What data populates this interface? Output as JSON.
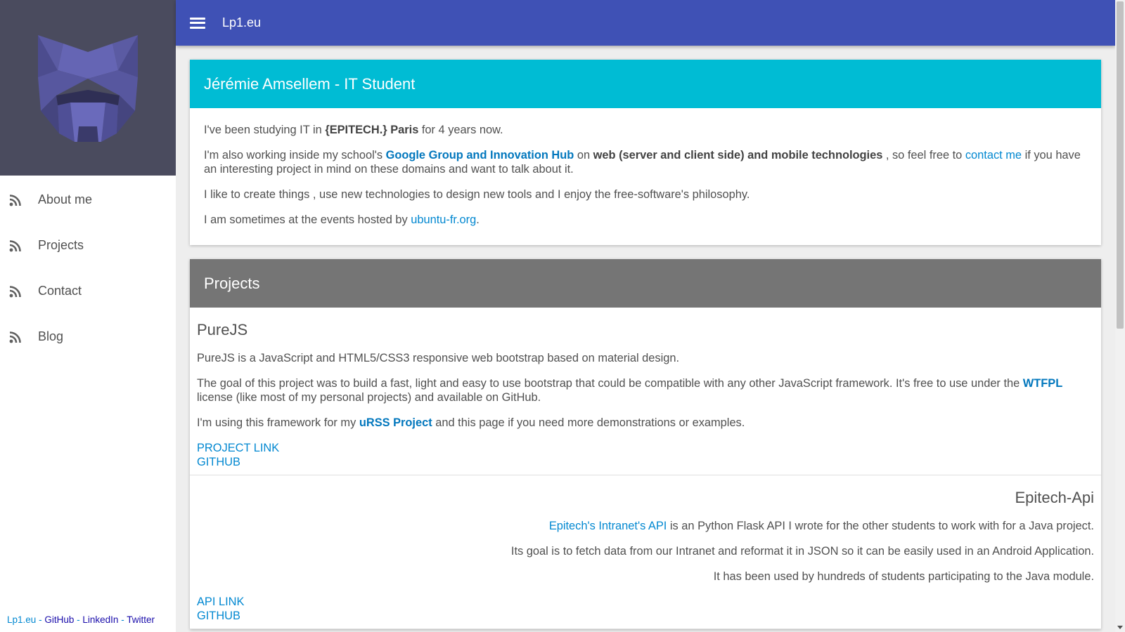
{
  "sidebar": {
    "logo": "wolf-logo",
    "items": [
      {
        "label": "About me",
        "icon": "rss-icon"
      },
      {
        "label": "Projects",
        "icon": "rss-icon"
      },
      {
        "label": "Contact",
        "icon": "rss-icon"
      },
      {
        "label": "Blog",
        "icon": "rss-icon"
      }
    ],
    "footer": {
      "home": "Lp1.eu",
      "github": "GitHub",
      "linkedin": "LinkedIn",
      "twitter": "Twitter",
      "separator": "-"
    }
  },
  "topbar": {
    "menu_icon": "hamburger-menu-icon",
    "title": "Lp1.eu"
  },
  "about": {
    "title": "Jérémie Amsellem - IT Student",
    "p1": {
      "t1": "I've been studying IT in ",
      "school": "{EPITECH.} Paris",
      "t2": " for 4 years now."
    },
    "p2": {
      "t1": "I'm also working inside my school's ",
      "group": "Google Group and Innovation Hub",
      "t2": " on ",
      "tech": "web (server and client side) and mobile technologies",
      "t3": " , so feel free to ",
      "contact": "contact me",
      "t4": " if you have an interesting project in mind on these domains and want to talk about it."
    },
    "p3": "I like to create things , use new technologies to design new tools and I enjoy the free-software's philosophy.",
    "p4": {
      "t1": "I am sometimes at the events hosted by ",
      "link": "ubuntu-fr.org",
      "t2": "."
    }
  },
  "projects": {
    "title": "Projects",
    "purejs": {
      "name": "PureJS",
      "p1": "PureJS is a JavaScript and HTML5/CSS3 responsive web bootstrap based on material design.",
      "p2a": "The goal of this project was to build a fast, light and easy to use bootstrap that could be compatible with any other JavaScript framework. It's free to use under the ",
      "license": "WTFPL",
      "p2b": " license (like most of my personal projects) and available on GitHub.",
      "p3a": "I'm using this framework for my ",
      "urss": "uRSS Project",
      "p3b": " and this page if you need more demonstrations or examples.",
      "link1": "PROJECT LINK",
      "link2": "GITHUB"
    },
    "epitech_api": {
      "name": "Epitech-Api",
      "p1_link": "Epitech's Intranet's API",
      "p1": " is an Python Flask API I wrote for the other students to work with for a Java project.",
      "p2": "Its goal is to fetch data from our Intranet and reformat it in JSON so it can be easily used in an Android Application.",
      "p3": "It has been used by hundreds of students participating to the Java module.",
      "link1": "API LINK",
      "link2": "GITHUB"
    }
  },
  "colors": {
    "topbar": "#3f51b5",
    "about_header": "#00bcd4",
    "projects_header": "#757575",
    "link": "#0288d1",
    "sidebar_logo_bg": "#4a4b5e"
  }
}
